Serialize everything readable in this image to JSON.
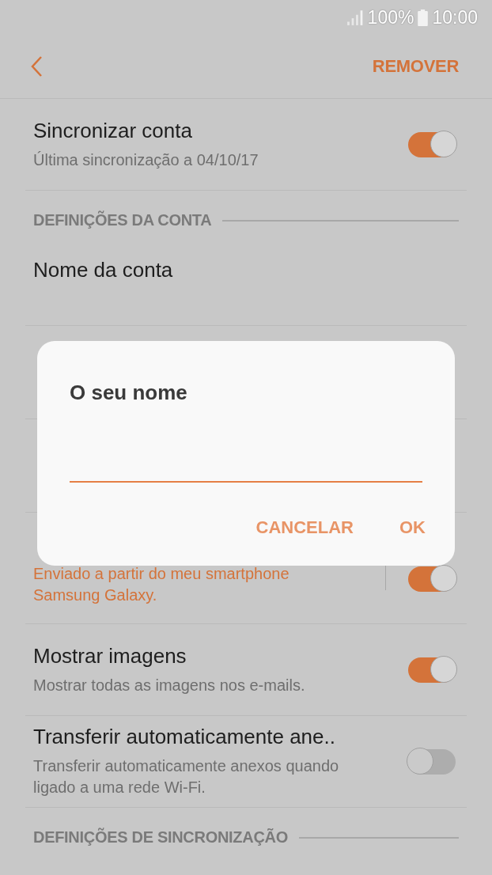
{
  "status_bar": {
    "battery": "100%",
    "time": "10:00"
  },
  "header": {
    "action": "REMOVER"
  },
  "items": [
    {
      "kind": "toggle_row",
      "title": "Sincronizar conta",
      "subtitle": "Última sincronização a 04/10/17",
      "accent": false,
      "on": true,
      "split": false
    },
    {
      "kind": "section",
      "title": "DEFINIÇÕES DA CONTA"
    },
    {
      "kind": "row",
      "title": "Nome da conta"
    },
    {
      "kind": "covered"
    },
    {
      "kind": "covered"
    },
    {
      "kind": "toggle_row",
      "subtitle": "Enviado a partir do meu smartphone Samsung Galaxy.",
      "accent": true,
      "on": true,
      "split": true
    },
    {
      "kind": "toggle_row",
      "title": "Mostrar imagens",
      "subtitle": "Mostrar todas as imagens nos e-mails.",
      "accent": false,
      "on": true,
      "split": false
    },
    {
      "kind": "toggle_row",
      "title": "Transferir automaticamente ane..",
      "subtitle": "Transferir automaticamente anexos quando ligado a uma rede Wi-Fi.",
      "accent": false,
      "on": false,
      "split": false
    },
    {
      "kind": "section",
      "title": "DEFINIÇÕES DE SINCRONIZAÇÃO"
    }
  ],
  "dialog": {
    "title": "O seu nome",
    "buttons": [
      "CANCELAR",
      "OK"
    ]
  }
}
